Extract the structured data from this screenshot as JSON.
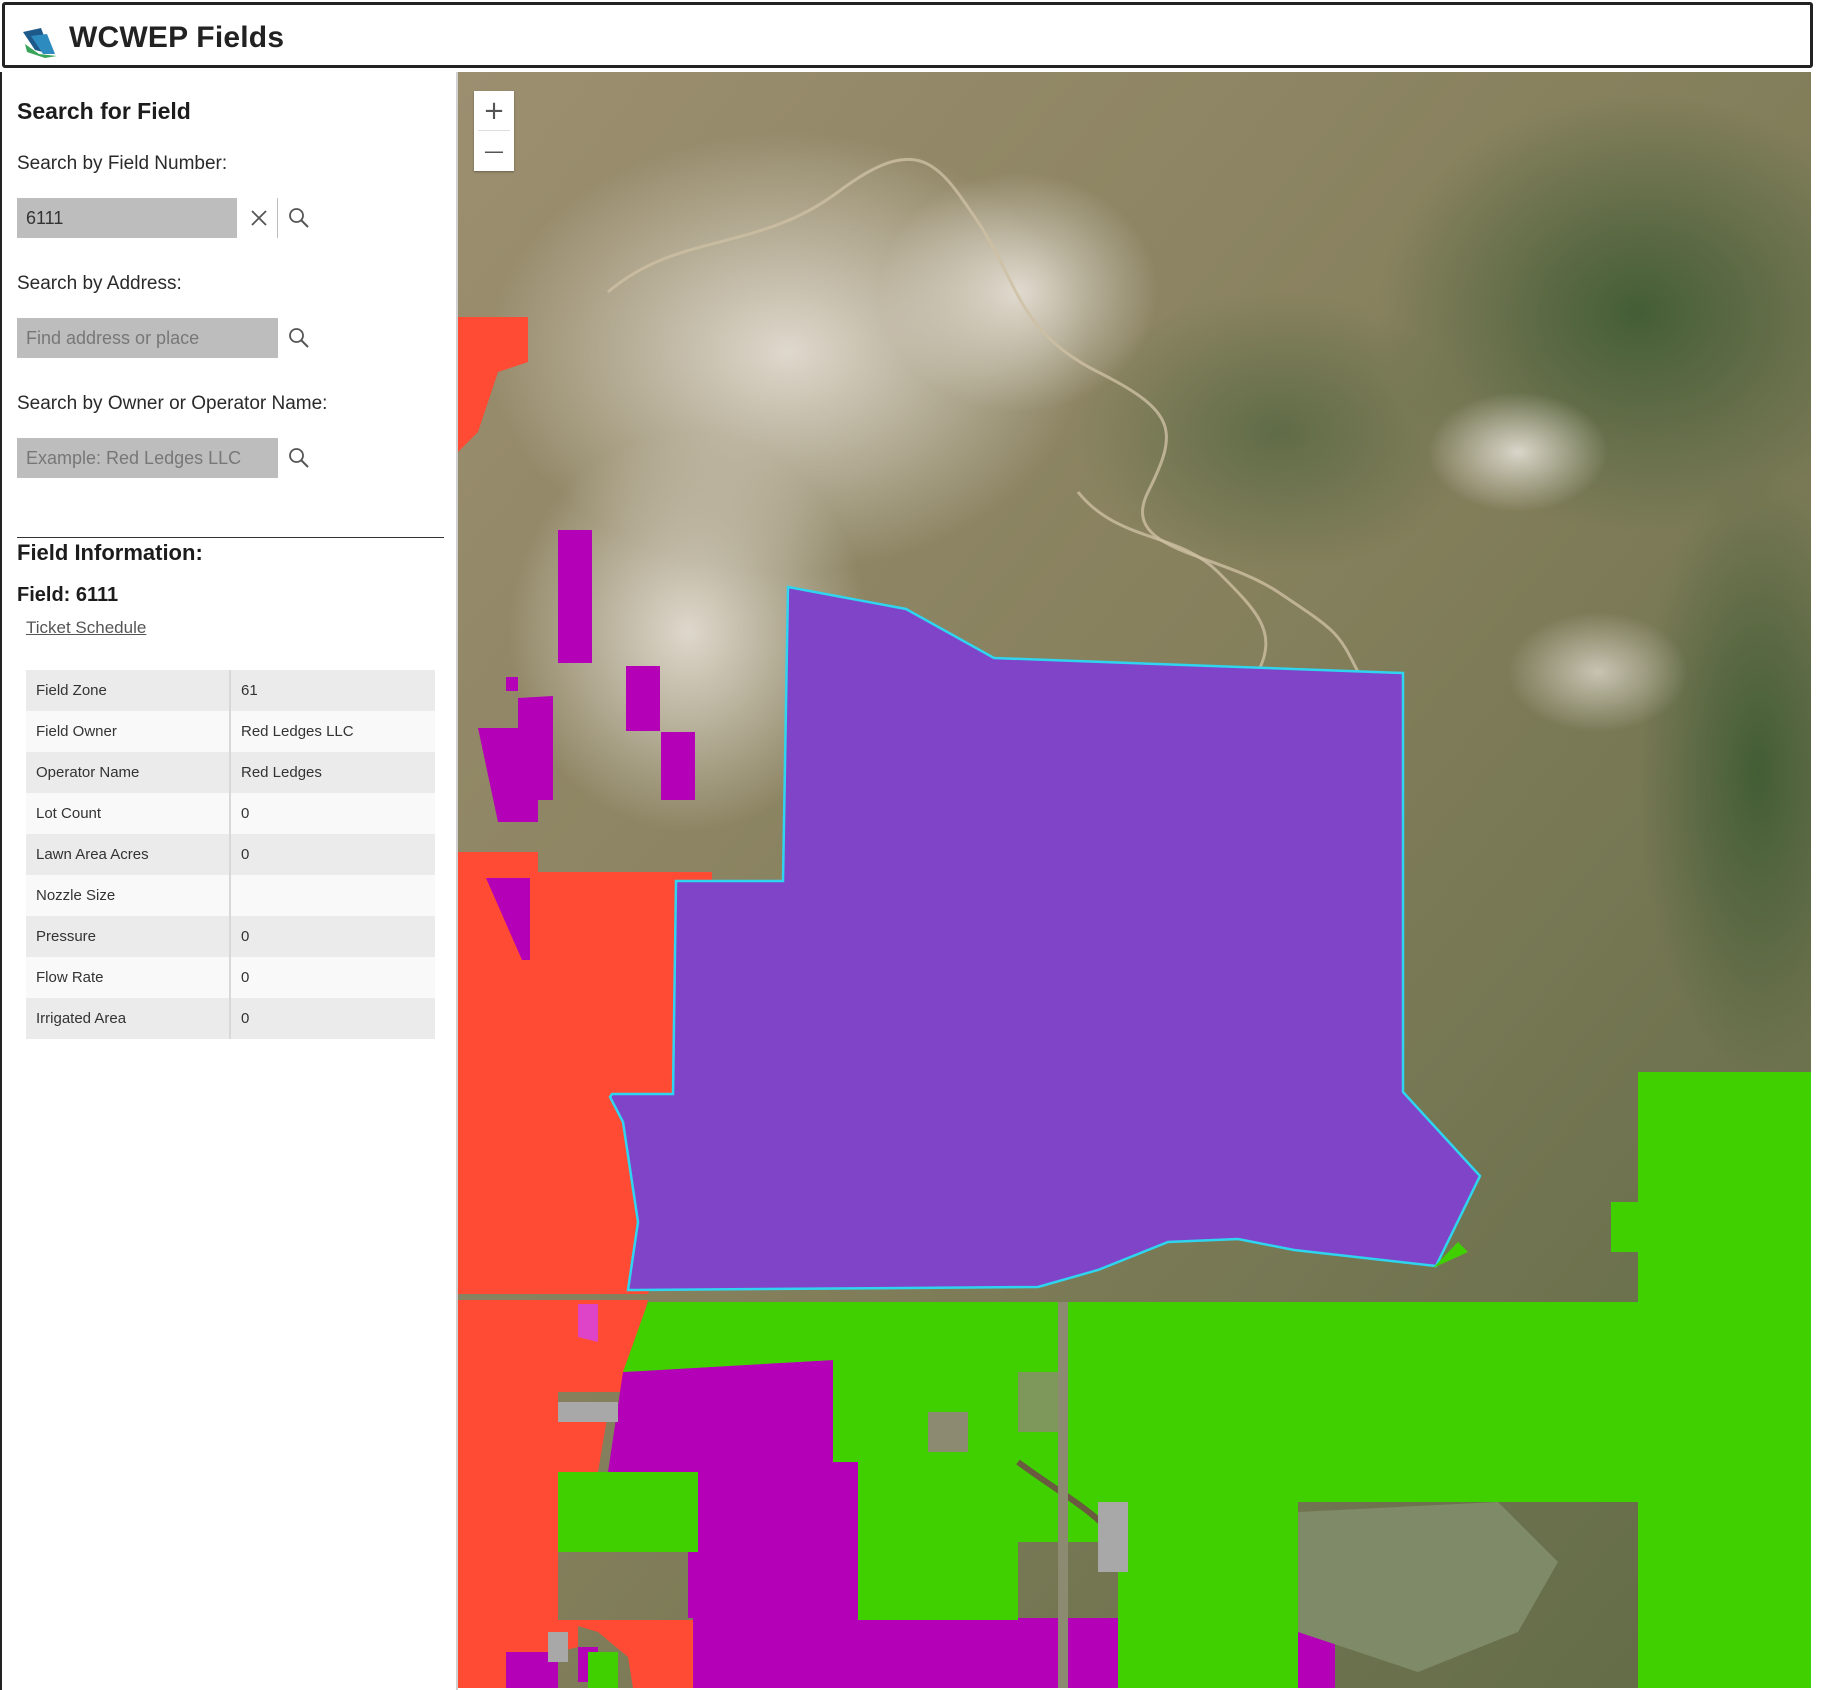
{
  "app": {
    "title": "WCWEP Fields"
  },
  "search": {
    "heading": "Search for Field",
    "field_number": {
      "label": "Search by Field Number:",
      "value": "6111"
    },
    "address": {
      "label": "Search by Address:",
      "placeholder": "Find address or place"
    },
    "owner": {
      "label": "Search by Owner or Operator Name:",
      "placeholder": "Example: Red Ledges LLC"
    }
  },
  "info": {
    "heading": "Field Information:",
    "field_title": "Field: 6111",
    "link": "Ticket Schedule",
    "rows": [
      {
        "key": "Field Zone",
        "value": "61"
      },
      {
        "key": "Field Owner",
        "value": "Red Ledges LLC"
      },
      {
        "key": "Operator Name",
        "value": "Red Ledges"
      },
      {
        "key": "Lot Count",
        "value": "0"
      },
      {
        "key": "Lawn Area Acres",
        "value": "0"
      },
      {
        "key": "Nozzle Size",
        "value": ""
      },
      {
        "key": "Pressure",
        "value": "0"
      },
      {
        "key": "Flow Rate",
        "value": "0"
      },
      {
        "key": "Irrigated Area",
        "value": "0"
      }
    ]
  },
  "map": {
    "zoom_in": "+",
    "zoom_out": "—",
    "colors": {
      "selected_fill": "#8044c8",
      "selected_outline": "#2fd5ef",
      "zone_red": "#ff4b33",
      "zone_magenta": "#b400b6",
      "zone_green": "#40d000"
    }
  }
}
